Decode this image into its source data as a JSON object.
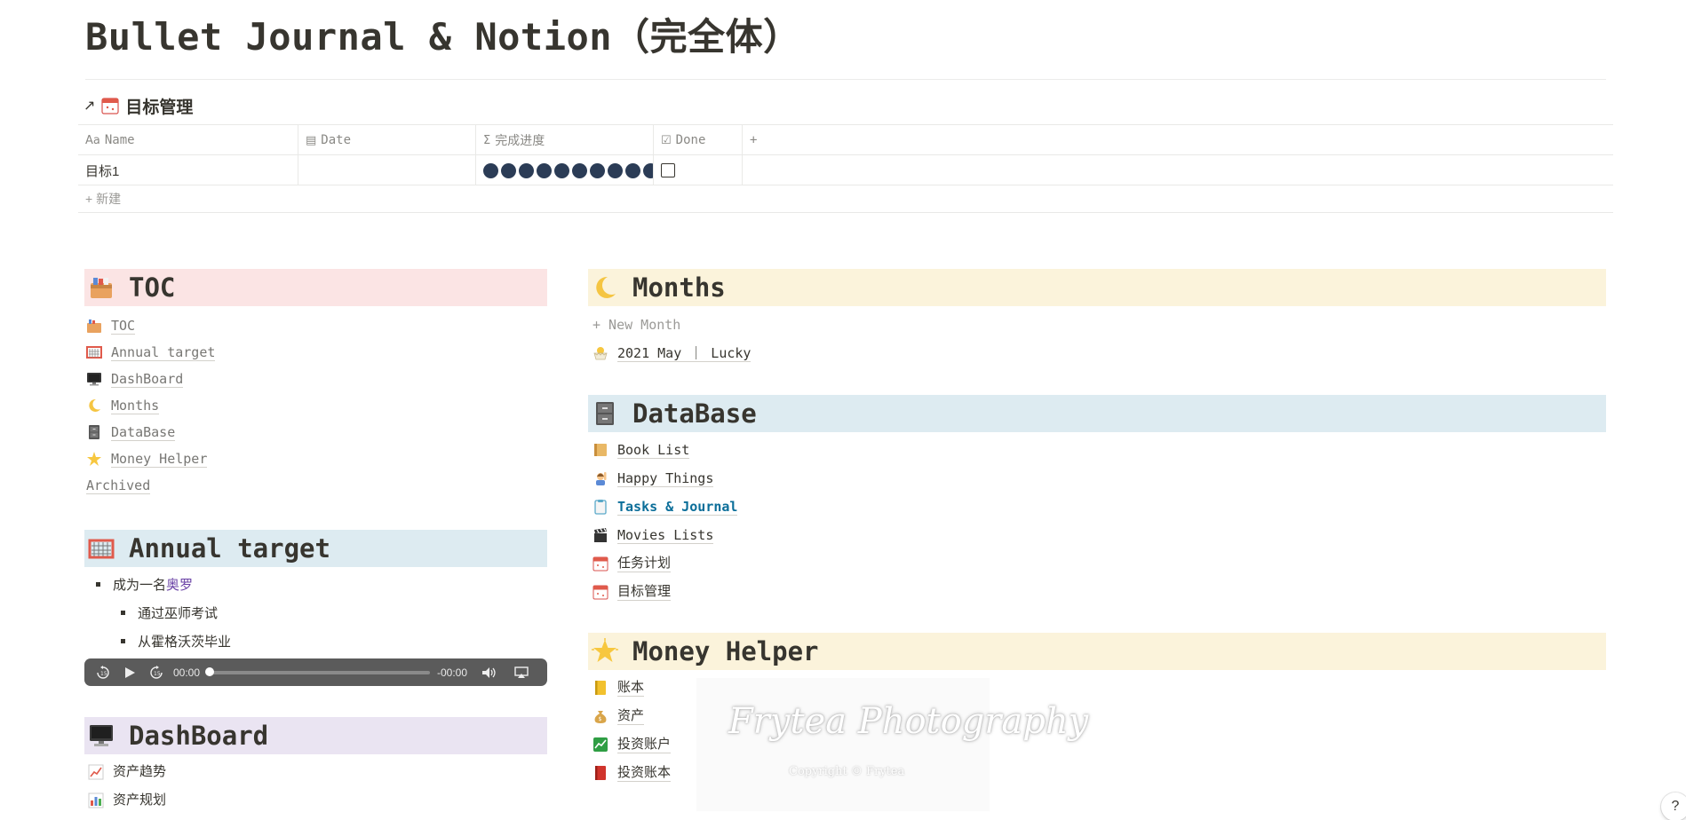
{
  "page": {
    "title": "Bullet Journal & Notion（完全体）"
  },
  "colors": {
    "dot": "#2b3c56",
    "red_bg": "#fbe4e4",
    "yellow_bg": "#fbf3db",
    "blue_bg": "#ddebf1",
    "purple_bg": "#eae4f2",
    "link_blue": "#0b6e99",
    "purple_text": "#6940a5"
  },
  "linked_db": {
    "arrow": "↗",
    "title": "目标管理",
    "icon": "calendar-icon",
    "columns": [
      {
        "icon": "Aa",
        "label": "Name"
      },
      {
        "icon": "▤",
        "label": "Date"
      },
      {
        "icon": "Σ",
        "label": "完成进度"
      },
      {
        "icon": "☑",
        "label": "Done"
      }
    ],
    "add_column": "+",
    "rows": [
      {
        "name": "目标1",
        "date": "",
        "progress_dots": 10,
        "done": false
      }
    ],
    "new_label": "+ 新建"
  },
  "toc": {
    "heading": "TOC",
    "heading_icon": "card-file-box-icon",
    "items": [
      {
        "icon": "card-file-box-icon",
        "label": "TOC"
      },
      {
        "icon": "goal-net-icon",
        "label": "Annual target"
      },
      {
        "icon": "desktop-computer-icon",
        "label": "DashBoard"
      },
      {
        "icon": "crescent-moon-icon",
        "label": "Months"
      },
      {
        "icon": "file-cabinet-icon",
        "label": "DataBase"
      },
      {
        "icon": "glowing-star-icon",
        "label": "Money Helper"
      }
    ],
    "archived": "Archived"
  },
  "annual": {
    "heading": "Annual target",
    "heading_icon": "goal-net-icon",
    "items": [
      {
        "text": "成为一名",
        "highlight": "奥罗",
        "level": 0
      },
      {
        "text": "通过巫师考试",
        "level": 1
      },
      {
        "text": "从霍格沃茨毕业",
        "level": 1
      }
    ],
    "audio": {
      "current": "00:00",
      "remaining": "-00:00",
      "rewind": "15",
      "forward": "15"
    }
  },
  "dashboard": {
    "heading": "DashBoard",
    "heading_icon": "desktop-computer-icon",
    "items": [
      {
        "icon": "chart-increasing-icon",
        "label": "资产趋势"
      },
      {
        "icon": "bar-chart-icon",
        "label": "资产规划"
      }
    ]
  },
  "months": {
    "heading": "Months",
    "heading_icon": "crescent-moon-icon",
    "new_label": "+ New Month",
    "items": [
      {
        "icon": "hatching-chick-icon",
        "label": "2021 May ｜ Lucky"
      }
    ]
  },
  "database": {
    "heading": "DataBase",
    "heading_icon": "file-cabinet-icon",
    "items": [
      {
        "icon": "book-icon",
        "label": "Book List"
      },
      {
        "icon": "person-raising-hand-icon",
        "label": "Happy Things"
      },
      {
        "icon": "clipboard-icon",
        "label": "Tasks & Journal"
      },
      {
        "icon": "clapper-board-icon",
        "label": "Movies Lists"
      },
      {
        "icon": "calendar-icon",
        "label": "任务计划"
      },
      {
        "icon": "calendar-icon",
        "label": "目标管理"
      }
    ]
  },
  "money": {
    "heading": "Money Helper",
    "heading_icon": "glowing-star-icon",
    "items": [
      {
        "icon": "ledger-icon",
        "label": "账本"
      },
      {
        "icon": "money-bag-icon",
        "label": "资产"
      },
      {
        "icon": "chart-yen-icon",
        "label": "投资账户"
      },
      {
        "icon": "closed-book-icon",
        "label": "投资账本"
      }
    ]
  },
  "watermark": {
    "title": "Frytea Photography",
    "copyright": "Copyright © Frytea"
  },
  "help": "?"
}
